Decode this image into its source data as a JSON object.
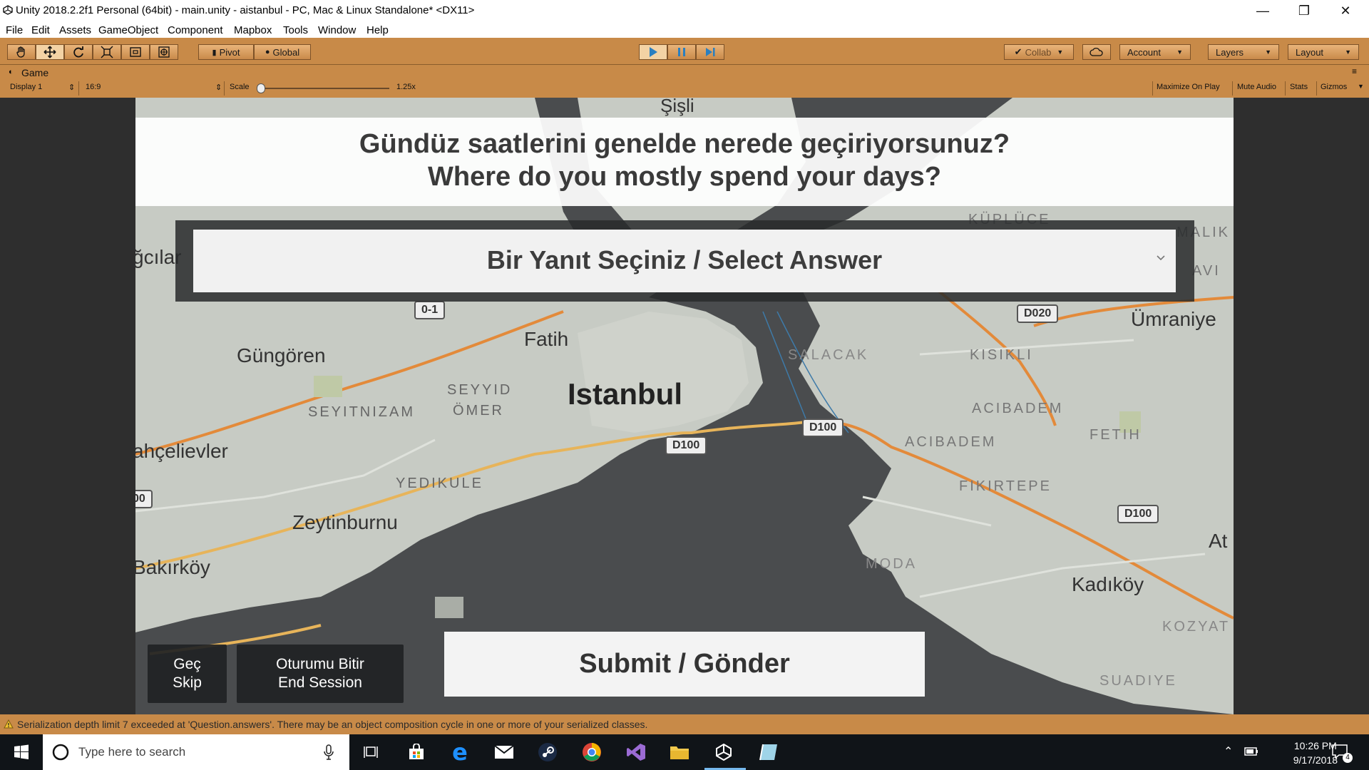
{
  "window": {
    "title": "Unity 2018.2.2f1 Personal (64bit) - main.unity - aistanbul - PC, Mac & Linux Standalone* <DX11>",
    "minimize": "—",
    "maximize": "❐",
    "close": "✕"
  },
  "menu": [
    "File",
    "Edit",
    "Assets",
    "GameObject",
    "Component",
    "Mapbox",
    "Tools",
    "Window",
    "Help"
  ],
  "toolbar": {
    "pivot": "Pivot",
    "global": "Global",
    "collab": "Collab",
    "account": "Account",
    "layers": "Layers",
    "layout": "Layout",
    "accent": "#c88a48"
  },
  "game_tab": {
    "tab_label": "Game",
    "display": "Display 1",
    "aspect": "16:9",
    "scale_label": "Scale",
    "scale_value": "1.25x",
    "scale_fraction": 0,
    "maximize_on_play": "Maximize On Play",
    "mute_audio": "Mute Audio",
    "stats": "Stats",
    "gizmos": "Gizmos"
  },
  "map": {
    "labels": [
      "Şişli",
      "Güngören",
      "Fatih",
      "Istanbul",
      "SEYYID",
      "ÖMER",
      "SEYITNIZAM",
      "ahçelievler",
      "YEDIKULE",
      "Zeytinburnu",
      "Bakırköy",
      "SALACAK",
      "KISIKLI",
      "ACIBADEM",
      "ACIBADEM",
      "FETIH",
      "FIKIRTEPE",
      "Ümraniye",
      "Kadıköy",
      "MODA",
      "KOZYAT",
      "SUADIYE",
      "ğcılar",
      "KÜPLÜCE",
      "MALIK",
      "AVI",
      "At"
    ],
    "shields": [
      "0-1",
      "D020",
      "D100",
      "D100",
      "D100",
      "00"
    ]
  },
  "survey": {
    "question_tr": "Gündüz saatlerini genelde nerede geçiriyorsunuz?",
    "question_en": "Where do you mostly spend your days?",
    "dropdown_value": "Bir Yanıt Seçiniz / Select Answer",
    "skip_tr": "Geç",
    "skip_en": "Skip",
    "end_tr": "Oturumu Bitir",
    "end_en": "End Session",
    "submit": "Submit / Gönder"
  },
  "console": {
    "message": "Serialization depth limit 7 exceeded at 'Question.answers'. There may be an object composition cycle in one or more of your serialized classes."
  },
  "taskbar": {
    "search_placeholder": "Type here to search",
    "time": "10:26 PM",
    "date": "9/17/2018",
    "notification_count": "4"
  }
}
